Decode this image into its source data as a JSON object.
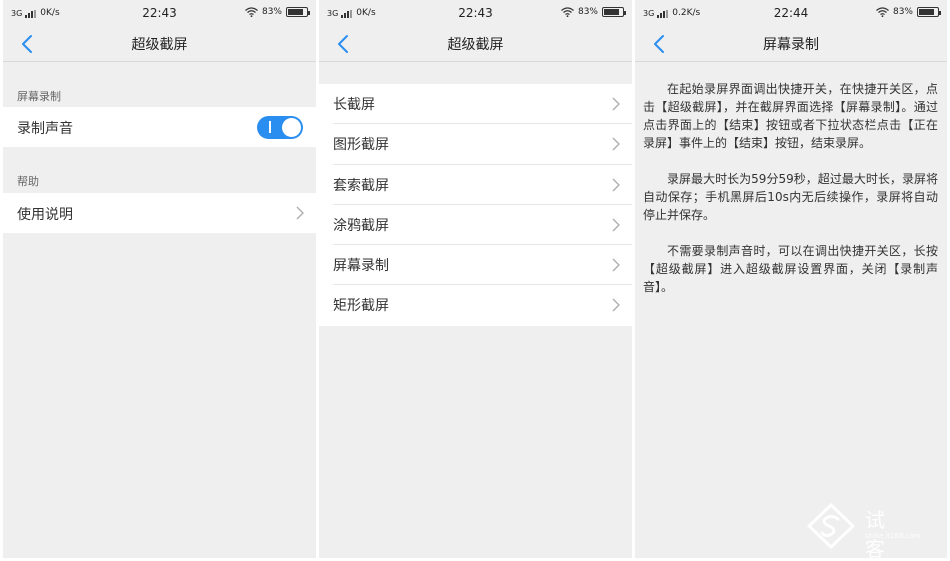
{
  "screens": [
    {
      "status": {
        "network": "3G",
        "speed": "0K/s",
        "time": "22:43",
        "battery": "83%"
      },
      "title": "超级截屏",
      "sections": [
        {
          "label": "屏幕录制",
          "row_label": "录制声音",
          "toggle_on": true
        },
        {
          "label": "帮助",
          "row_label": "使用说明"
        }
      ]
    },
    {
      "status": {
        "network": "3G",
        "speed": "0K/s",
        "time": "22:43",
        "battery": "83%"
      },
      "title": "超级截屏",
      "items": [
        "长截屏",
        "图形截屏",
        "套索截屏",
        "涂鸦截屏",
        "屏幕录制",
        "矩形截屏"
      ]
    },
    {
      "status": {
        "network": "3G",
        "speed": "0.2K/s",
        "time": "22:44",
        "battery": "83%"
      },
      "title": "屏幕录制",
      "paragraphs": [
        "在起始录屏界面调出快捷开关，在快捷开关区，点击【超级截屏】，并在截屏界面选择【屏幕录制】。通过点击界面上的【结束】按钮或者下拉状态栏点击【正在录屏】事件上的【结束】按钮，结束录屏。",
        "录屏最大时长为59分59秒，超过最大时长，录屏将自动保存；手机黑屏后10s内无后续操作，录屏将自动停止并保存。",
        "不需要录制声音时，可以在调出快捷开关区，长按【超级截屏】进入超级截屏设置界面，关闭【录制声音】。"
      ]
    }
  ],
  "watermark": {
    "text": "试客",
    "sub": "shike.it168.com"
  },
  "colors": {
    "accent": "#2a8ef0",
    "background": "#efefef",
    "row": "#ffffff"
  }
}
